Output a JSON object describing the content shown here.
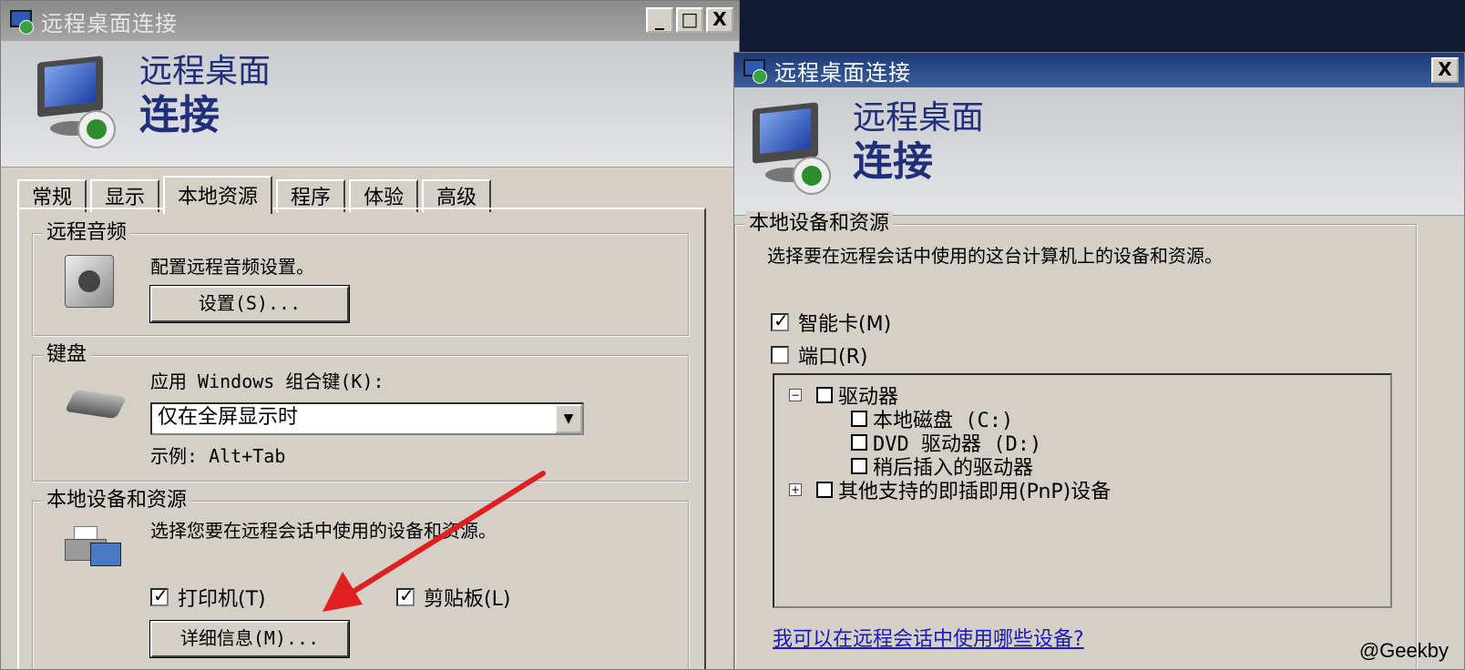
{
  "window1": {
    "title": "远程桌面连接",
    "controls": [
      "_",
      "□",
      "X"
    ],
    "banner": {
      "line1": "远程桌面",
      "line2": "连接"
    },
    "tabs": [
      "常规",
      "显示",
      "本地资源",
      "程序",
      "体验",
      "高级"
    ],
    "active_tab": "本地资源",
    "audio": {
      "group_label": "远程音频",
      "description": "配置远程音频设置。",
      "settings_button": "设置(S)..."
    },
    "keyboard": {
      "group_label": "键盘",
      "label": "应用 Windows 组合键(K):",
      "selected": "仅在全屏显示时",
      "example": "示例: Alt+Tab"
    },
    "devices": {
      "group_label": "本地设备和资源",
      "description": "选择您要在远程会话中使用的设备和资源。",
      "printer": {
        "label": "打印机(T)",
        "checked": true
      },
      "clipboard": {
        "label": "剪贴板(L)",
        "checked": true
      },
      "details_button": "详细信息(M)..."
    }
  },
  "window2": {
    "title": "远程桌面连接",
    "close": "X",
    "banner": {
      "line1": "远程桌面",
      "line2": "连接"
    },
    "group_label": "本地设备和资源",
    "description": "选择要在远程会话中使用的这台计算机上的设备和资源。",
    "smartcard": {
      "label": "智能卡(M)",
      "checked": true
    },
    "ports": {
      "label": "端口(R)",
      "checked": false
    },
    "tree": {
      "drives": {
        "expander": "−",
        "label": "驱动器"
      },
      "drive_items": [
        "本地磁盘 (C:)",
        "DVD 驱动器 (D:)",
        "稍后插入的驱动器"
      ],
      "pnp": {
        "expander": "+",
        "label": "其他支持的即插即用(PnP)设备"
      }
    },
    "help_link": "我可以在远程会话中使用哪些设备?"
  },
  "watermark": "@Geekby",
  "colors": {
    "banner_title": "#1f2f7a",
    "title_active": "#1e3b75",
    "arrow": "#e02020",
    "link": "#1a1ab8"
  }
}
